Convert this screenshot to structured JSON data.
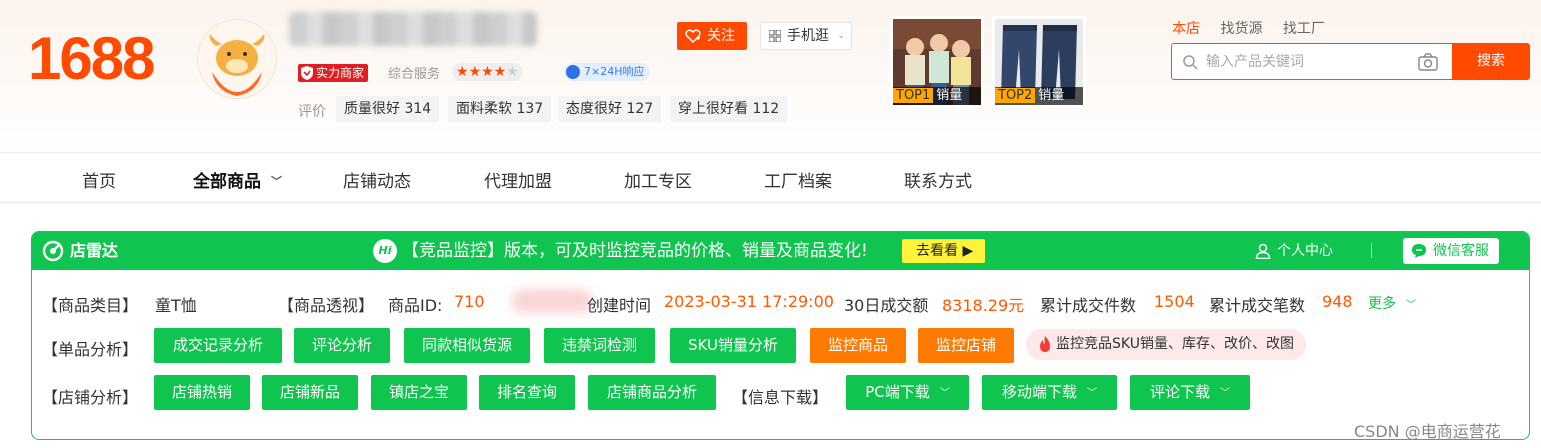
{
  "header": {
    "logo": "1688",
    "shop_badge": "实力商家",
    "service_label": "综合服务",
    "service_stars": 4,
    "service_stars_max": 5,
    "response_badge": "7×24H响应",
    "eval_label": "评价",
    "tags": [
      {
        "text": "质量很好 314"
      },
      {
        "text": "面料柔软 137"
      },
      {
        "text": "态度很好 127"
      },
      {
        "text": "穿上很好看 112"
      }
    ],
    "follow_label": "关注",
    "mobile_label": "手机逛",
    "top_products": [
      {
        "rank": "TOP1",
        "label": "销量"
      },
      {
        "rank": "TOP2",
        "label": "销量"
      }
    ],
    "search_tabs": [
      "本店",
      "找货源",
      "找工厂"
    ],
    "search_placeholder": "输入产品关键词",
    "search_button": "搜索"
  },
  "nav": {
    "items": [
      "首页",
      "全部商品",
      "店铺动态",
      "代理加盟",
      "加工专区",
      "工厂档案",
      "联系方式"
    ]
  },
  "plugin": {
    "brand": "店雷达",
    "hi": "Hi",
    "message": "【竞品监控】版本，可及时监控竞品的价格、销量及商品变化!",
    "go_label": "去看看",
    "user_center": "个人中心",
    "wechat": "微信客服",
    "info": {
      "category_label": "【商品类目】",
      "category_value": "童T恤",
      "insight_label": "【商品透视】",
      "id_label": "商品ID:",
      "id_value": "710",
      "created_label": "创建时间",
      "created_value": "2023-03-31 17:29:00",
      "sales30_label": "30日成交额",
      "sales30_value": "8318.29元",
      "pieces_label": "累计成交件数",
      "pieces_value": "1504",
      "orders_label": "累计成交笔数",
      "orders_value": "948",
      "more": "更多"
    },
    "single_label": "【单品分析】",
    "single_buttons": [
      "成交记录分析",
      "评论分析",
      "同款相似货源",
      "违禁词检测",
      "SKU销量分析"
    ],
    "monitor_buttons": [
      "监控商品",
      "监控店铺"
    ],
    "monitor_pill": "监控竞品SKU销量、库存、改价、改图",
    "shop_label": "【店铺分析】",
    "shop_buttons": [
      "店铺热销",
      "店铺新品",
      "镇店之宝",
      "排名查询",
      "店铺商品分析"
    ],
    "download_label": "【信息下载】",
    "download_buttons": [
      "PC端下载",
      "移动端下载",
      "评论下载"
    ]
  },
  "watermark": "CSDN @电商运营花",
  "colors": {
    "brand_orange": "#ff4a00",
    "plugin_green": "#10c54f",
    "monitor_orange": "#ff7a00"
  }
}
